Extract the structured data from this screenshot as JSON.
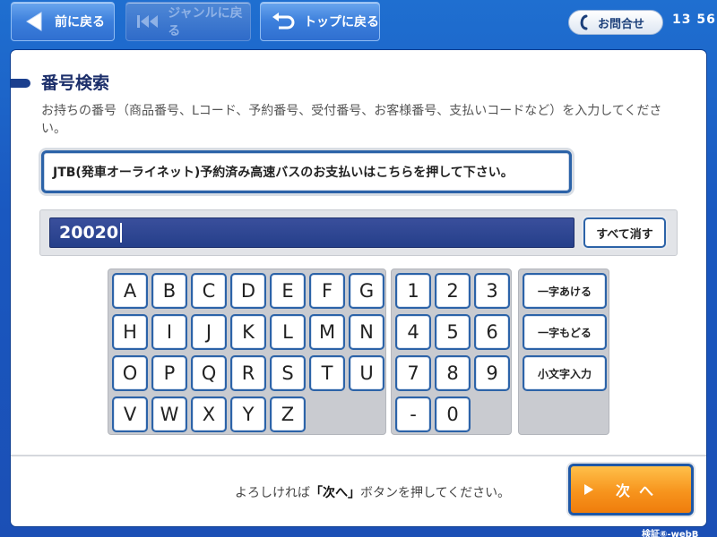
{
  "topbar": {
    "back_label": "前に戻る",
    "genre_back_label": "ジャンルに戻る",
    "top_label": "トップに戻る",
    "contact_label": "お問合せ",
    "time": "13 56"
  },
  "main": {
    "title": "番号検索",
    "description": "お持ちの番号（商品番号、Lコード、予約番号、受付番号、お客様番号、支払いコードなど）を入力してください。",
    "jtb_button_label": "JTB(発車オーライネット)予約済み高速バスのお支払いはこちらを押して下さい。",
    "input_value": "20020",
    "clear_label": "すべて消す"
  },
  "keyboard": {
    "alpha_rows": [
      [
        "A",
        "B",
        "C",
        "D",
        "E",
        "F",
        "G"
      ],
      [
        "H",
        "I",
        "J",
        "K",
        "L",
        "M",
        "N"
      ],
      [
        "O",
        "P",
        "Q",
        "R",
        "S",
        "T",
        "U"
      ],
      [
        "V",
        "W",
        "X",
        "Y",
        "Z"
      ]
    ],
    "num_rows": [
      [
        "1",
        "2",
        "3"
      ],
      [
        "4",
        "5",
        "6"
      ],
      [
        "7",
        "8",
        "9"
      ],
      [
        "-",
        "0"
      ]
    ],
    "func_keys": [
      "一字あける",
      "一字もどる",
      "小文字入力"
    ]
  },
  "footer": {
    "prompt_before": "よろしければ",
    "prompt_bold": "「次へ」",
    "prompt_after": "ボタンを押してください。",
    "next_label": "次へ"
  },
  "verification_label": "検証⑥-webB",
  "colors": {
    "accent_blue": "#2c63a8",
    "next_orange": "#f7941d",
    "input_navy": "#253f8a"
  }
}
